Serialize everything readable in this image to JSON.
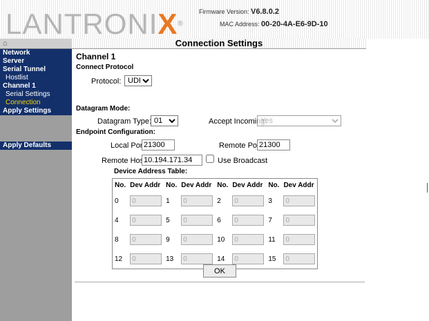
{
  "header": {
    "logo": {
      "part1": "LANTRONI",
      "part2": "X",
      "reg": "®"
    },
    "firmware_label": "Firmware Version:",
    "firmware_value": "V6.8.0.2",
    "mac_label": "MAC Address:",
    "mac_value": "00-20-4A-E6-9D-10"
  },
  "sidebar": {
    "home_icon": "⌂",
    "items": [
      {
        "label": "Network"
      },
      {
        "label": "Server"
      },
      {
        "label": "Serial Tunnel"
      },
      {
        "label": "Hostlist"
      },
      {
        "label": "Channel 1"
      },
      {
        "label": "Serial Settings"
      },
      {
        "label": "Connection"
      },
      {
        "label": "Apply Settings"
      },
      {
        "label": "Apply Defaults"
      }
    ]
  },
  "page_title": "Connection Settings",
  "form": {
    "channel_heading": "Channel 1",
    "connect_protocol_heading": "Connect Protocol",
    "protocol_label": "Protocol:",
    "protocol_value": "UDP",
    "datagram_mode_heading": "Datagram Mode:",
    "datagram_type_label": "Datagram Type:",
    "datagram_type_value": "01",
    "accept_incoming_label": "Accept Incoming:",
    "accept_incoming_value": "Yes",
    "endpoint_heading": "Endpoint Configuration:",
    "local_port_label": "Local Port:",
    "local_port_value": "21300",
    "remote_port_label": "Remote Port:",
    "remote_port_value": "21300",
    "remote_host_label": "Remote Host:",
    "remote_host_value": "10.194.171.34",
    "use_broadcast_label": "Use Broadcast",
    "device_table_heading": "Device Address Table:",
    "ok_label": "OK"
  },
  "device_table": {
    "headers": [
      "No.",
      "Dev Addr",
      "No.",
      "Dev Addr",
      "No.",
      "Dev Addr",
      "No.",
      "Dev Addr"
    ],
    "rows": [
      [
        {
          "no": "0",
          "addr": "0"
        },
        {
          "no": "1",
          "addr": "0"
        },
        {
          "no": "2",
          "addr": "0"
        },
        {
          "no": "3",
          "addr": "0"
        }
      ],
      [
        {
          "no": "4",
          "addr": "0"
        },
        {
          "no": "5",
          "addr": "0"
        },
        {
          "no": "6",
          "addr": "0"
        },
        {
          "no": "7",
          "addr": "0"
        }
      ],
      [
        {
          "no": "8",
          "addr": "0"
        },
        {
          "no": "9",
          "addr": "0"
        },
        {
          "no": "10",
          "addr": "0"
        },
        {
          "no": "11",
          "addr": "0"
        }
      ],
      [
        {
          "no": "12",
          "addr": "0"
        },
        {
          "no": "13",
          "addr": "0"
        },
        {
          "no": "14",
          "addr": "0"
        },
        {
          "no": "15",
          "addr": "0"
        }
      ]
    ]
  },
  "colors": {
    "sidebar": "#9e9e9e",
    "nav_highlight": "#13306b",
    "current_item": "#f5d400",
    "logo_x": "#e87722"
  }
}
